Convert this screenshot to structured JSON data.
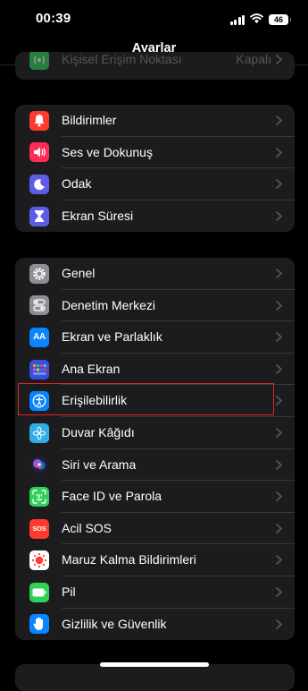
{
  "status_bar": {
    "time": "00:39",
    "battery": "46"
  },
  "nav": {
    "title": "Ayarlar"
  },
  "partial_row": {
    "label": "Kişisel Erişim Noktası",
    "value": "Kapalı",
    "icon": "hotspot-icon",
    "color": "#30d158"
  },
  "groups": [
    {
      "items": [
        {
          "label": "Bildirimler",
          "icon": "bell-icon",
          "color": "#ff3b30"
        },
        {
          "label": "Ses ve Dokunuş",
          "icon": "speaker-icon",
          "color": "#ff2d55"
        },
        {
          "label": "Odak",
          "icon": "moon-icon",
          "color": "#5e5ce6"
        },
        {
          "label": "Ekran Süresi",
          "icon": "hourglass-icon",
          "color": "#5e5ce6"
        }
      ]
    },
    {
      "items": [
        {
          "label": "Genel",
          "icon": "gear-icon",
          "color": "#8e8e93"
        },
        {
          "label": "Denetim Merkezi",
          "icon": "toggles-icon",
          "color": "#8e8e93"
        },
        {
          "label": "Ekran ve Parlaklık",
          "icon": "text-size-icon",
          "color": "#0a84ff",
          "icon_text": "AA"
        },
        {
          "label": "Ana Ekran",
          "icon": "app-grid-icon",
          "color": "#3a4fd8"
        },
        {
          "label": "Erişilebilirlik",
          "icon": "accessibility-icon",
          "color": "#0a84ff"
        },
        {
          "label": "Duvar Kâğıdı",
          "icon": "flower-icon",
          "color": "#32ade6"
        },
        {
          "label": "Siri ve Arama",
          "icon": "siri-icon",
          "color": "#1c1c1e"
        },
        {
          "label": "Face ID ve Parola",
          "icon": "face-id-icon",
          "color": "#30d158"
        },
        {
          "label": "Acil SOS",
          "icon": "sos-icon",
          "color": "#ff3b30",
          "icon_text": "SOS"
        },
        {
          "label": "Maruz Kalma Bildirimleri",
          "icon": "exposure-icon",
          "color": "#ffffff"
        },
        {
          "label": "Pil",
          "icon": "battery-icon",
          "color": "#30d158"
        },
        {
          "label": "Gizlilik ve Güvenlik",
          "icon": "hand-icon",
          "color": "#0a84ff"
        }
      ]
    }
  ],
  "highlight": {
    "item": "Erişilebilirlik",
    "color": "#e0242a"
  }
}
